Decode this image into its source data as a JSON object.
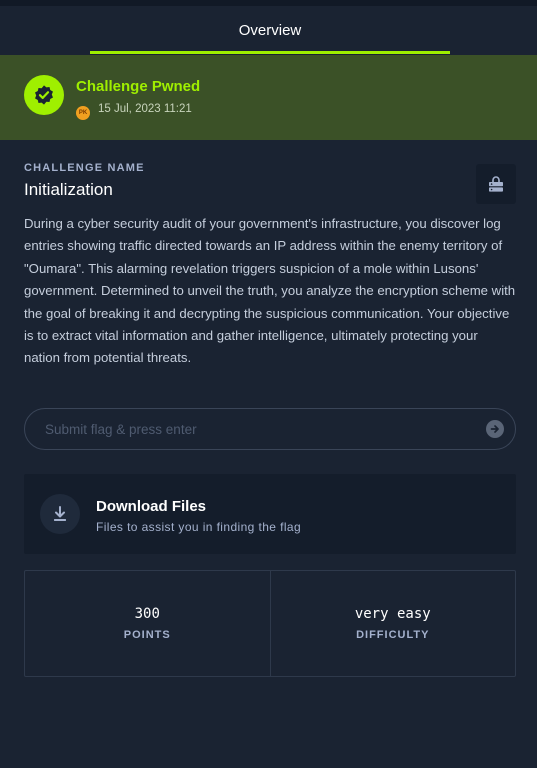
{
  "tabs": {
    "active": "Overview"
  },
  "pwned": {
    "title": "Challenge Pwned",
    "avatar_initials": "PK",
    "date": "15 Jul, 2023 11:21",
    "accent_color": "#9fef00"
  },
  "challenge": {
    "name_label": "CHALLENGE NAME",
    "name": "Initialization",
    "description": "During a cyber security audit of your government's infrastructure, you discover log entries showing traffic directed towards an IP address within the enemy territory of \"Oumara\". This alarming revelation triggers suspicion of a mole within Lusons' government. Determined to unveil the truth, you analyze the encryption scheme with the goal of breaking it and decrypting the suspicious communication. Your objective is to extract vital information and gather intelligence, ultimately protecting your nation from potential threats."
  },
  "flag": {
    "placeholder": "Submit flag & press enter",
    "value": ""
  },
  "download": {
    "title": "Download Files",
    "subtitle": "Files to assist you in finding the flag"
  },
  "stats": [
    {
      "value": "300",
      "label": "POINTS"
    },
    {
      "value": "very easy",
      "label": "DIFFICULTY"
    }
  ],
  "icons": {
    "pwned_badge": "verified-check-icon",
    "lock": "lock-server-icon",
    "submit": "arrow-right-icon",
    "download": "download-icon"
  }
}
